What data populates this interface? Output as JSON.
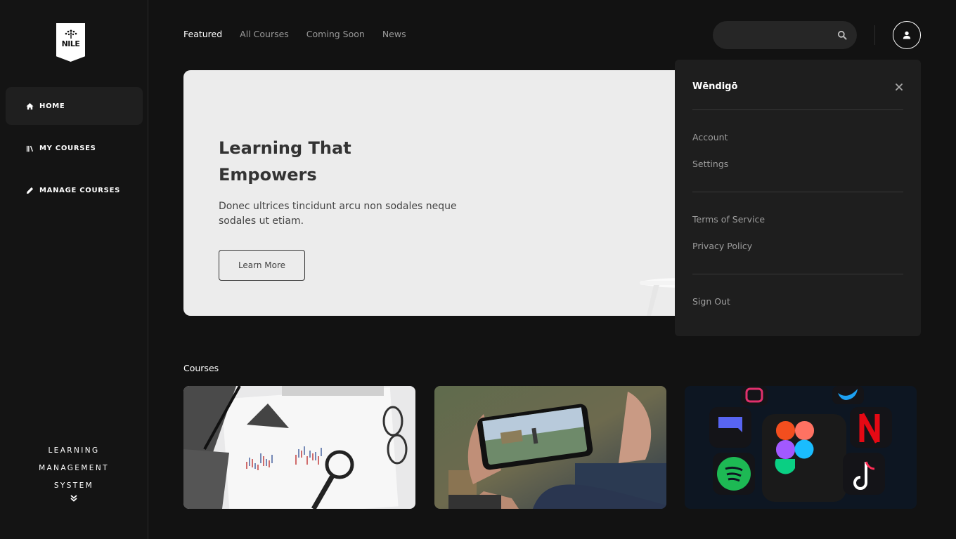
{
  "app": {
    "logo_text": "NILE"
  },
  "sidebar": {
    "items": [
      {
        "label": "HOME",
        "icon": "home-icon"
      },
      {
        "label": "MY COURSES",
        "icon": "books-icon"
      },
      {
        "label": "MANAGE COURSES",
        "icon": "pencil-icon"
      }
    ],
    "footer": [
      "LEARNING",
      "MANAGEMENT",
      "SYSTEM"
    ],
    "footer_icon": "chevrons-down-icon"
  },
  "topnav": {
    "tabs": [
      {
        "label": "Featured"
      },
      {
        "label": "All Courses"
      },
      {
        "label": "Coming Soon"
      },
      {
        "label": "News"
      }
    ]
  },
  "search": {
    "placeholder": "",
    "value": "",
    "icon": "search-icon"
  },
  "user_menu": {
    "username": "Wēndigō",
    "group1": [
      "Account",
      "Settings"
    ],
    "group2": [
      "Terms of Service",
      "Privacy Policy"
    ],
    "group3": [
      "Sign Out"
    ]
  },
  "hero": {
    "title_line1": "Learning That",
    "title_line2": "Empowers",
    "subtitle": "Donec ultrices tincidunt arcu non sodales neque sodales ut etiam.",
    "button": "Learn More"
  },
  "courses": {
    "title": "Courses",
    "cards": [
      {
        "image": "finance-chart-image"
      },
      {
        "image": "mobile-gaming-image"
      },
      {
        "image": "social-apps-image"
      }
    ]
  },
  "colors": {
    "background": "#121212",
    "sidebar": "#141414",
    "hero": "#ececec",
    "menu": "#1e1e1e"
  }
}
